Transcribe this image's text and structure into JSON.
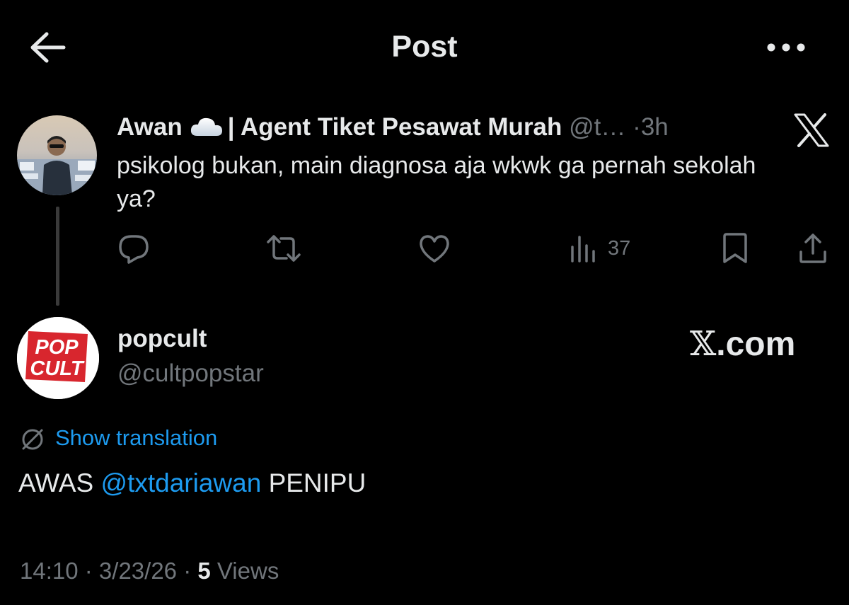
{
  "header": {
    "title": "Post",
    "back_icon": "arrow-left-icon",
    "more_icon": "more-horizontal-icon"
  },
  "parent_post": {
    "display_name": "Awan",
    "name_emoji": "cloud-emoji",
    "name_suffix": "| Agent Tiket Pesawat Murah",
    "handle": "@t…",
    "separator": "·",
    "time": "3h",
    "text": "psikolog bukan, main diagnosa aja wkwk ga pernah sekolah ya?",
    "views": "37",
    "watermark_icon": "x-logo-icon"
  },
  "post": {
    "display_name": "popcult",
    "handle": "@cultpopstar",
    "avatar_text": [
      "POP",
      "CULT"
    ],
    "watermark": {
      "x": "𝕏",
      "domain": ".com"
    },
    "show_translation": "Show translation",
    "text_prefix": "AWAS",
    "mention": "@txtdariawan",
    "text_suffix": "PENIPU",
    "time": "14:10",
    "date": "3/23/26",
    "views_count": "5",
    "views_label": "Views"
  },
  "colors": {
    "background": "#000000",
    "text": "#e7e9ea",
    "muted": "#71767b",
    "link": "#1d9bf0",
    "avatar_red": "#d8262e"
  }
}
